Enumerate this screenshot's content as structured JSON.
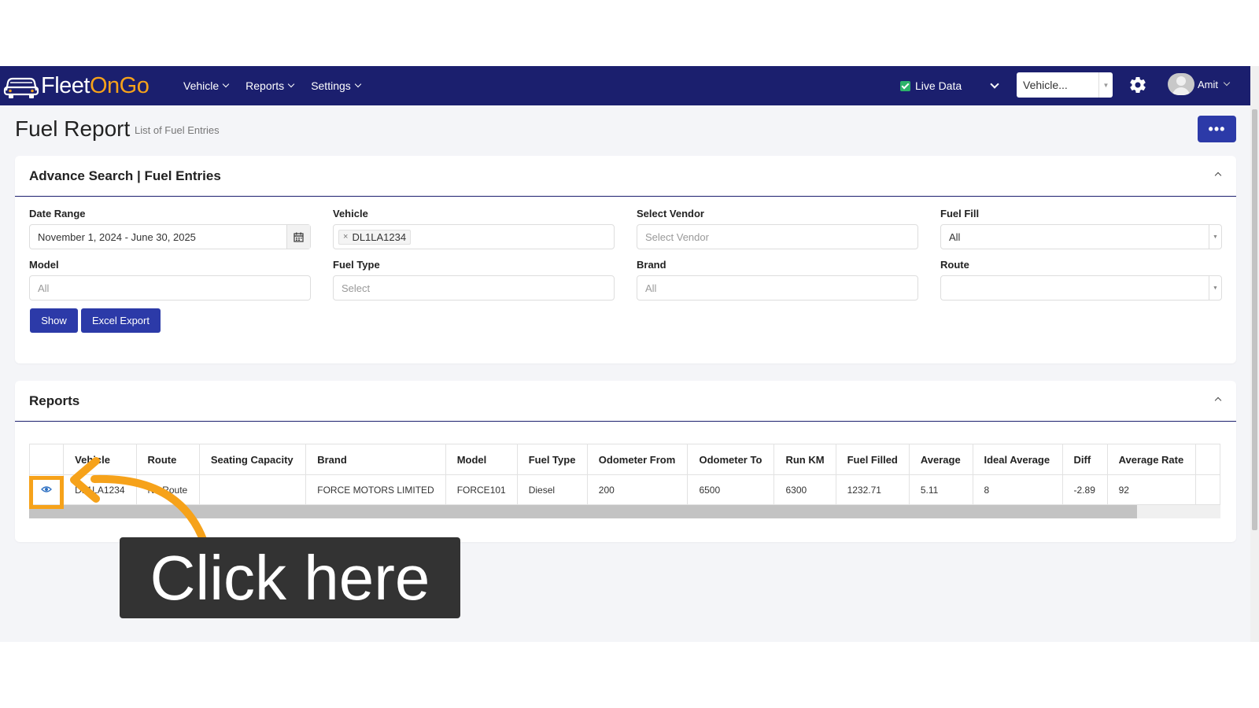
{
  "app": {
    "logo_part1": "Fleet",
    "logo_part2": "OnGo"
  },
  "nav": {
    "menu": [
      {
        "label": "Vehicle"
      },
      {
        "label": "Reports"
      },
      {
        "label": "Settings"
      }
    ],
    "live_data_label": "Live Data",
    "live_data_checked": true,
    "vehicle_select": "Vehicle...",
    "user_name": "Amit"
  },
  "header": {
    "title": "Fuel Report",
    "subtitle": "List of Fuel Entries",
    "more_label": "•••"
  },
  "search": {
    "title": "Advance Search | Fuel Entries",
    "date_range": {
      "label": "Date Range",
      "value": "November 1, 2024 - June 30, 2025"
    },
    "vehicle": {
      "label": "Vehicle",
      "tag": "DL1LA1234"
    },
    "vendor": {
      "label": "Select Vendor",
      "placeholder": "Select Vendor"
    },
    "fuel_fill": {
      "label": "Fuel Fill",
      "value": "All"
    },
    "model": {
      "label": "Model",
      "placeholder": "All"
    },
    "fuel_type": {
      "label": "Fuel Type",
      "placeholder": "Select"
    },
    "brand": {
      "label": "Brand",
      "placeholder": "All"
    },
    "route": {
      "label": "Route",
      "value": ""
    },
    "show_label": "Show",
    "export_label": "Excel Export"
  },
  "reports": {
    "title": "Reports",
    "columns": [
      "",
      "Vehicle",
      "Route",
      "Seating Capacity",
      "Brand",
      "Model",
      "Fuel Type",
      "Odometer From",
      "Odometer To",
      "Run KM",
      "Fuel Filled",
      "Average",
      "Ideal Average",
      "Diff",
      "Average Rate",
      ""
    ],
    "rows": [
      [
        "",
        "DL1LA1234",
        "No Route",
        "",
        "FORCE MOTORS LIMITED",
        "FORCE101",
        "Diesel",
        "200",
        "6500",
        "6300",
        "1232.71",
        "5.11",
        "8",
        "-2.89",
        "92",
        ""
      ]
    ]
  },
  "annotation": {
    "callout_text": "Click here",
    "accent_color": "#f6a21a"
  },
  "colors": {
    "navbar": "#1b1f6e",
    "primary_button": "#2c3aa8",
    "logo_accent": "#f6a21a"
  }
}
